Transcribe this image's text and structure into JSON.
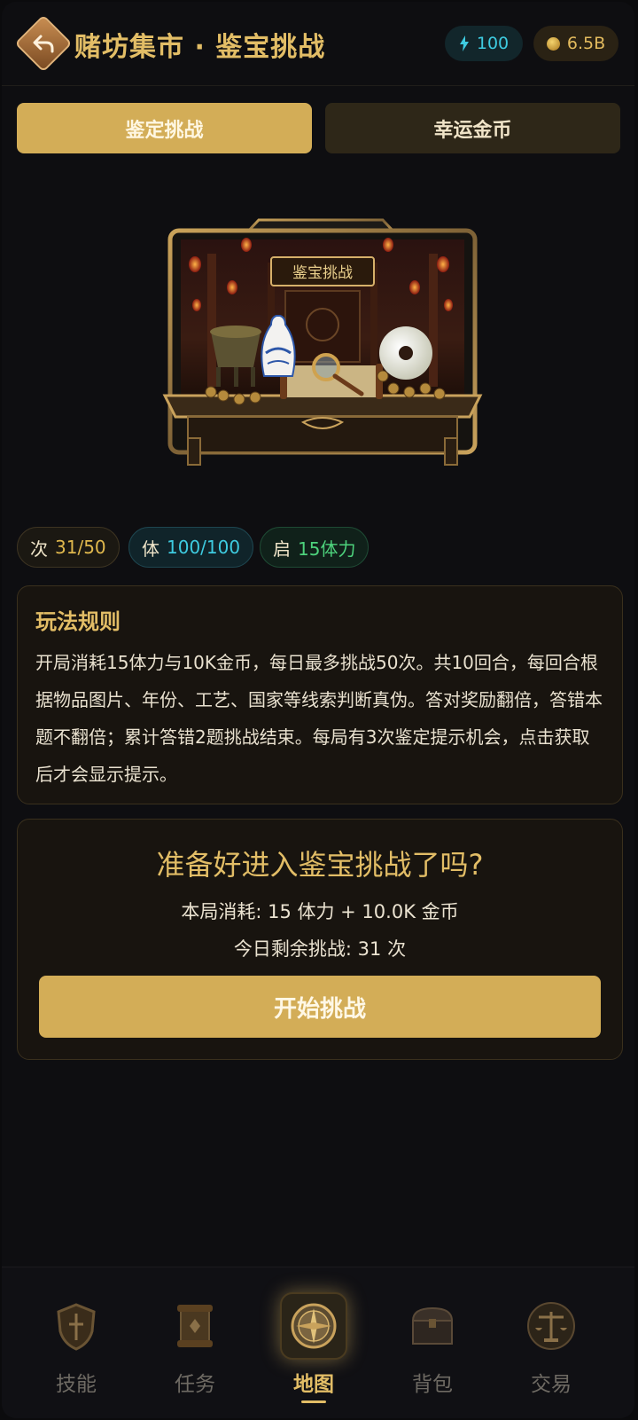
{
  "header": {
    "title": "赌坊集市 · 鉴宝挑战",
    "energy": "100",
    "coins": "6.5B"
  },
  "tabs": [
    {
      "label": "鉴定挑战",
      "active": true
    },
    {
      "label": "幸运金币",
      "active": false
    }
  ],
  "artwork": {
    "sign_text": "鉴宝挑战"
  },
  "stats": [
    {
      "key": "次",
      "value": "31/50"
    },
    {
      "key": "体",
      "value": "100/100"
    },
    {
      "key": "启",
      "value": "15体力"
    }
  ],
  "rules": {
    "title": "玩法规则",
    "body": "开局消耗15体力与10K金币，每日最多挑战50次。共10回合，每回合根据物品图片、年份、工艺、国家等线索判断真伪。答对奖励翻倍，答错本题不翻倍；累计答错2题挑战结束。每局有3次鉴定提示机会，点击获取后才会显示提示。"
  },
  "ready": {
    "title": "准备好进入鉴宝挑战了吗?",
    "cost": "本局消耗: 15 体力 + 10.0K 金币",
    "remaining": "今日剩余挑战: 31 次",
    "button": "开始挑战"
  },
  "nav": [
    {
      "label": "技能",
      "icon": "shield-icon",
      "active": false
    },
    {
      "label": "任务",
      "icon": "scroll-icon",
      "active": false
    },
    {
      "label": "地图",
      "icon": "compass-icon",
      "active": true
    },
    {
      "label": "背包",
      "icon": "chest-icon",
      "active": false
    },
    {
      "label": "交易",
      "icon": "scales-icon",
      "active": false
    }
  ],
  "colors": {
    "accent_gold": "#d3ad57",
    "title_gold": "#e2bd66",
    "energy_cyan": "#3ecbe0",
    "green": "#4dd27c",
    "background": "#0e0e11"
  }
}
